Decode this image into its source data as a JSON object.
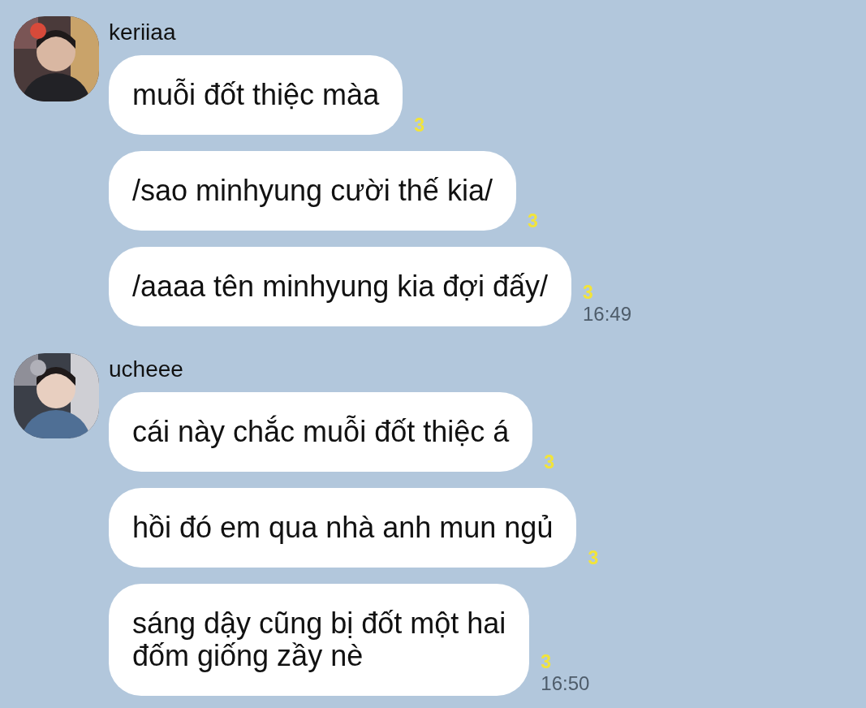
{
  "groups": [
    {
      "sender": "keriiaa",
      "messages": [
        {
          "text": "muỗi đốt thiệc màa",
          "read_count": "3"
        },
        {
          "text": "/sao minhyung cười thế kia/",
          "read_count": "3"
        },
        {
          "text": "/aaaa tên minhyung kia đợi đấy/",
          "read_count": "3",
          "time": "16:49"
        }
      ]
    },
    {
      "sender": "ucheee",
      "messages": [
        {
          "text": "cái này chắc muỗi đốt thiệc á",
          "read_count": "3"
        },
        {
          "text": "hồi đó em qua nhà anh mun ngủ",
          "read_count": "3"
        },
        {
          "text": "sáng dậy cũng bị đốt một hai\nđốm giống zầy nè",
          "read_count": "3",
          "time": "16:50"
        }
      ]
    }
  ]
}
